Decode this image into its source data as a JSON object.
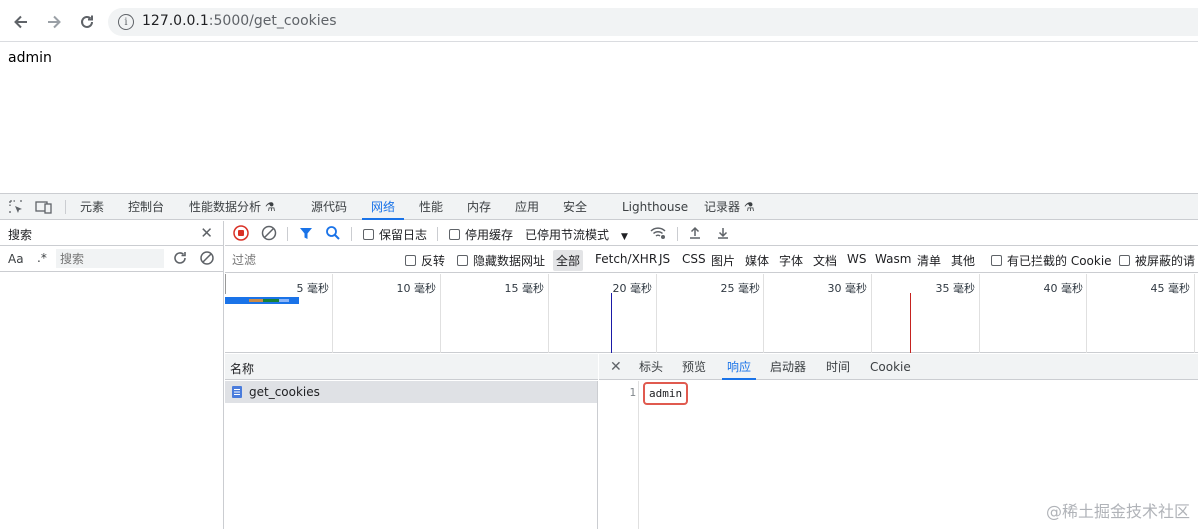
{
  "browser": {
    "back_icon": "arrow-left-icon",
    "forward_icon": "arrow-right-icon",
    "reload_icon": "reload-icon",
    "url_host": "127.0.0.1",
    "url_path": ":5000/get_cookies"
  },
  "page": {
    "body_text": "admin"
  },
  "devtools": {
    "tabs": [
      "元素",
      "控制台",
      "性能数据分析 ⚗",
      "源代码",
      "网络",
      "性能",
      "内存",
      "应用",
      "安全",
      "Lighthouse",
      "记录器 ⚗"
    ],
    "active_tab": "网络",
    "search": {
      "title": "搜索",
      "aa": "Aa",
      "regex": ".*",
      "placeholder": "搜索"
    },
    "toolbar": {
      "preserve_log": "保留日志",
      "disable_cache": "停用缓存",
      "throttle": "已停用节流模式"
    },
    "filter": {
      "placeholder": "过滤",
      "invert": "反转",
      "hide_data_urls": "隐藏数据网址",
      "types": [
        "全部",
        "Fetch/XHR",
        "JS",
        "CSS",
        "图片",
        "媒体",
        "字体",
        "文档",
        "WS",
        "Wasm",
        "清单",
        "其他"
      ],
      "blocked_cookies": "有已拦截的 Cookie",
      "blocked_requests": "被屏蔽的请"
    },
    "timeline": {
      "labels": [
        "5 毫秒",
        "10 毫秒",
        "15 毫秒",
        "20 毫秒",
        "25 毫秒",
        "30 毫秒",
        "35 毫秒",
        "40 毫秒",
        "45 毫秒"
      ]
    },
    "requests": {
      "column_name": "名称",
      "items": [
        "get_cookies"
      ]
    },
    "detail": {
      "tabs": [
        "标头",
        "预览",
        "响应",
        "启动器",
        "时间",
        "Cookie"
      ],
      "active_tab": "响应",
      "line_number": "1",
      "response_text": "admin"
    }
  },
  "watermark": "@稀土掘金技术社区"
}
